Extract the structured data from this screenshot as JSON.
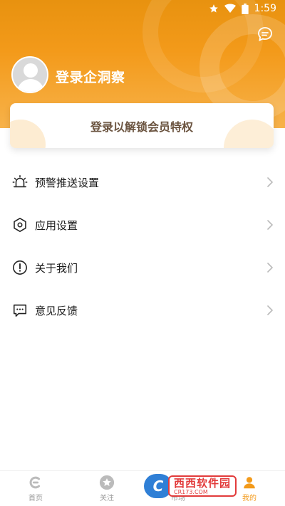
{
  "status_bar": {
    "time": "1:59"
  },
  "header": {
    "login_title": "登录企洞察",
    "message_icon": "message-icon"
  },
  "vip_card": {
    "text": "登录以解锁会员特权"
  },
  "menu": {
    "items": [
      {
        "label": "预警推送设置",
        "icon": "alarm-icon"
      },
      {
        "label": "应用设置",
        "icon": "hexagon-gear-icon"
      },
      {
        "label": "关于我们",
        "icon": "exclamation-circle-icon"
      },
      {
        "label": "意见反馈",
        "icon": "chat-bubble-icon"
      }
    ]
  },
  "tabbar": {
    "tabs": [
      {
        "label": "首页",
        "icon": "home-logo-icon"
      },
      {
        "label": "关注",
        "icon": "star-icon"
      },
      {
        "label": "市场",
        "icon": "market-icon"
      },
      {
        "label": "我的",
        "icon": "profile-icon"
      }
    ],
    "active_index": 3
  },
  "watermark": {
    "logo_letter": "C",
    "title": "西西软件园",
    "url": "CR173.COM"
  },
  "colors": {
    "accent": "#f39a1a",
    "header_top": "#e8920f",
    "vip_text": "#6b5440"
  }
}
